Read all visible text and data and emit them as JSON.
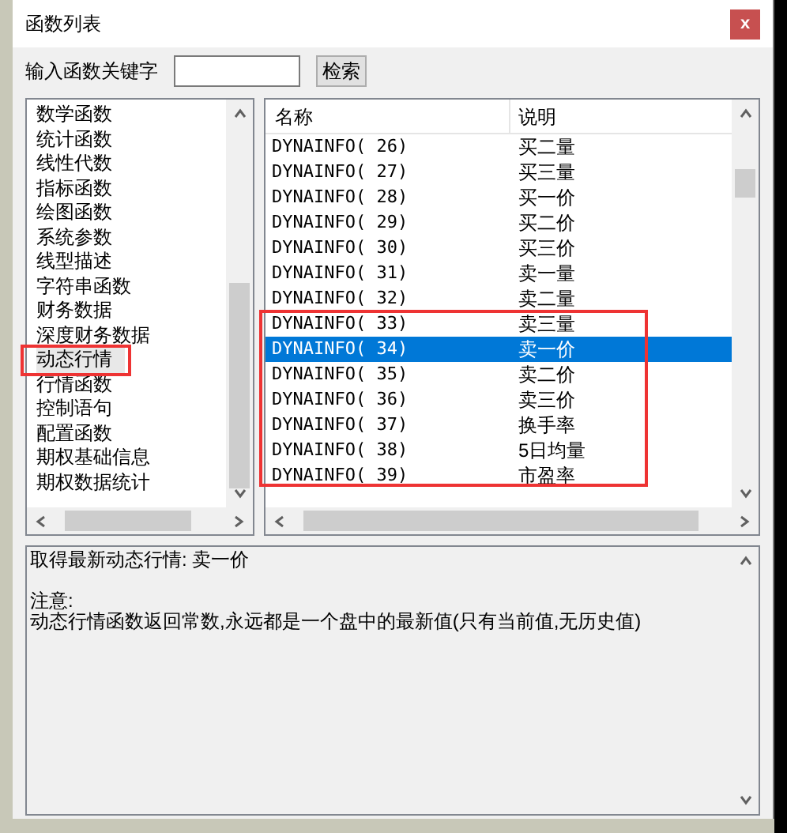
{
  "window": {
    "title": "函数列表",
    "close": "x"
  },
  "search": {
    "label": "输入函数关键字",
    "button": "检索"
  },
  "categories": [
    {
      "label": "数学函数",
      "selected": false
    },
    {
      "label": "统计函数",
      "selected": false
    },
    {
      "label": "线性代数",
      "selected": false
    },
    {
      "label": "指标函数",
      "selected": false
    },
    {
      "label": "绘图函数",
      "selected": false
    },
    {
      "label": "系统参数",
      "selected": false
    },
    {
      "label": "线型描述",
      "selected": false
    },
    {
      "label": "字符串函数",
      "selected": false
    },
    {
      "label": "财务数据",
      "selected": false
    },
    {
      "label": "深度财务数据",
      "selected": false
    },
    {
      "label": "动态行情",
      "selected": true
    },
    {
      "label": "行情函数",
      "selected": false
    },
    {
      "label": "控制语句",
      "selected": false
    },
    {
      "label": "配置函数",
      "selected": false
    },
    {
      "label": "期权基础信息",
      "selected": false
    },
    {
      "label": "期权数据统计",
      "selected": false
    }
  ],
  "table": {
    "columns": [
      "名称",
      "说明"
    ],
    "rows": [
      {
        "name": "DYNAINFO( 26)",
        "desc": "买二量",
        "selected": false
      },
      {
        "name": "DYNAINFO( 27)",
        "desc": "买三量",
        "selected": false
      },
      {
        "name": "DYNAINFO( 28)",
        "desc": "买一价",
        "selected": false
      },
      {
        "name": "DYNAINFO( 29)",
        "desc": "买二价",
        "selected": false
      },
      {
        "name": "DYNAINFO( 30)",
        "desc": "买三价",
        "selected": false
      },
      {
        "name": "DYNAINFO( 31)",
        "desc": "卖一量",
        "selected": false
      },
      {
        "name": "DYNAINFO( 32)",
        "desc": "卖二量",
        "selected": false
      },
      {
        "name": "DYNAINFO( 33)",
        "desc": "卖三量",
        "selected": false
      },
      {
        "name": "DYNAINFO( 34)",
        "desc": "卖一价",
        "selected": true
      },
      {
        "name": "DYNAINFO( 35)",
        "desc": "卖二价",
        "selected": false
      },
      {
        "name": "DYNAINFO( 36)",
        "desc": "卖三价",
        "selected": false
      },
      {
        "name": "DYNAINFO( 37)",
        "desc": "换手率",
        "selected": false
      },
      {
        "name": "DYNAINFO( 38)",
        "desc": "5日均量",
        "selected": false
      },
      {
        "name": "DYNAINFO( 39)",
        "desc": "市盈率",
        "selected": false
      }
    ]
  },
  "description": {
    "summary": "取得最新动态行情: 卖一价",
    "note_label": "注意:",
    "note": "动态行情函数返回常数,永远都是一个盘中的最新值(只有当前值,无历史值)"
  }
}
